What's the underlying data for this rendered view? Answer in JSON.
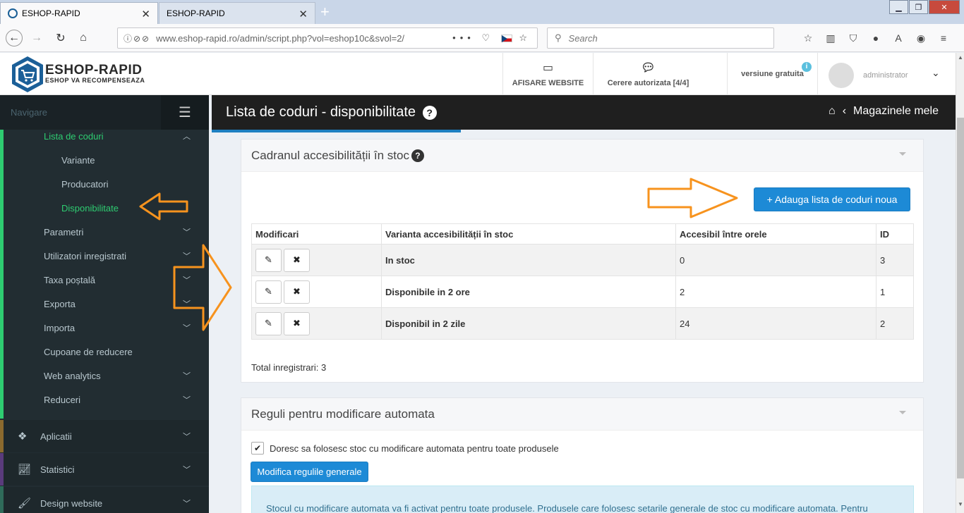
{
  "browser": {
    "tabs": [
      {
        "label": "ESHOP-RAPID",
        "active": true
      },
      {
        "label": "ESHOP-RAPID",
        "active": false
      }
    ],
    "url": "www.eshop-rapid.ro/admin/script.php?vol=eshop10c&svol=2/",
    "search_placeholder": "Search"
  },
  "header": {
    "brand": "ESHOP-RAPID",
    "brand_sub": "ESHOP VA RECOMPENSEAZA",
    "website_label": "AFISARE WEBSITE",
    "requests_label": "Cerere autorizata [4/4]",
    "version_label": "versiune gratuita",
    "user": "administrator"
  },
  "sidebar": {
    "nav_label": "Navigare",
    "items": [
      {
        "label": "Lista de coduri",
        "chevron": "up",
        "active": true
      },
      {
        "label": "Variante"
      },
      {
        "label": "Producatori"
      },
      {
        "label": "Disponibilitate",
        "active": true
      },
      {
        "label": "Parametri",
        "chevron": "down"
      },
      {
        "label": "Utilizatori inregistrati",
        "chevron": "down"
      },
      {
        "label": "Taxa poștală",
        "chevron": "down"
      },
      {
        "label": "Exporta",
        "chevron": "down"
      },
      {
        "label": "Importa",
        "chevron": "down"
      },
      {
        "label": "Cupoane de reducere"
      },
      {
        "label": "Web analytics",
        "chevron": "down"
      },
      {
        "label": "Reduceri",
        "chevron": "down"
      }
    ],
    "sections": [
      {
        "label": "Aplicatii",
        "accent": "#8b6a2e"
      },
      {
        "label": "Statistici",
        "accent": "#5a3b7c"
      },
      {
        "label": "Design website",
        "accent": "#2f6b5a"
      }
    ],
    "accent_color": "#2ecc71"
  },
  "page": {
    "title": "Lista de coduri - disponibilitate",
    "breadcrumb": "Magazinele mele"
  },
  "stock_box": {
    "title": "Cadranul accesibilității în stoc",
    "add_button": "+ Adauga lista de coduri noua",
    "columns": [
      "Modificari",
      "Varianta accesibilității în stoc",
      "Accesibil între orele",
      "ID"
    ],
    "rows": [
      {
        "name": "In stoc",
        "hours": "0",
        "id": "3"
      },
      {
        "name": "Disponibile in 2 ore",
        "hours": "2",
        "id": "1"
      },
      {
        "name": "Disponibil in 2 zile",
        "hours": "24",
        "id": "2"
      }
    ],
    "total": "Total inregistrari: 3"
  },
  "rules_box": {
    "title": "Reguli pentru modificare automata",
    "checkbox_label": "Doresc sa folosesc stoc cu modificare automata pentru toate produsele",
    "button": "Modifica regulile generale",
    "info": "Stocul cu modificare automata va fi activat pentru toate produsele. Produsele care folosesc setarile generale de stoc cu modificare automata. Pentru"
  },
  "colors": {
    "primary": "#1d8ad6",
    "annotation": "#f7931e",
    "sidebar_bg": "#222d32"
  }
}
